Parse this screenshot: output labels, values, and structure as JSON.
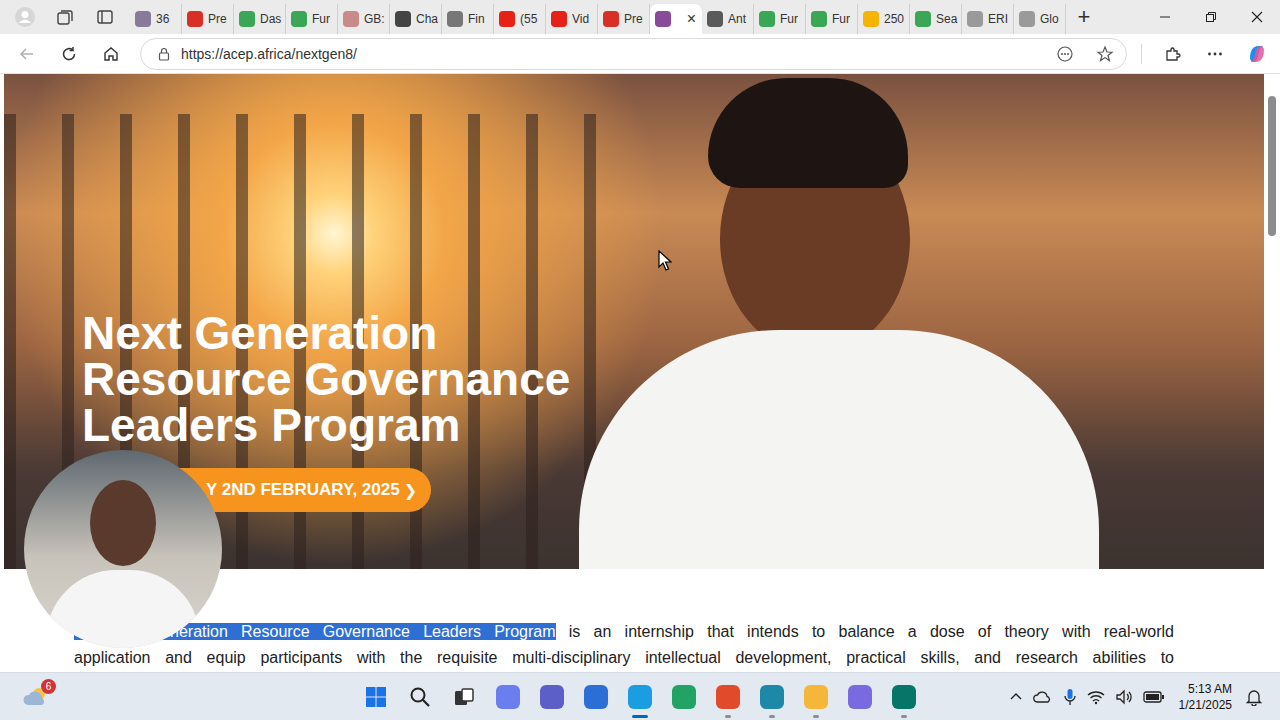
{
  "browser": {
    "tabs": [
      {
        "label": "36",
        "selected": false,
        "color": "#8a7a9a"
      },
      {
        "label": "Pre",
        "selected": false,
        "color": "#d93025"
      },
      {
        "label": "Das",
        "selected": false,
        "color": "#3aa757"
      },
      {
        "label": "Fur",
        "selected": false,
        "color": "#3aa757"
      },
      {
        "label": "GB:",
        "selected": false,
        "color": "#c98a8a"
      },
      {
        "label": "Cha",
        "selected": false,
        "color": "#444444"
      },
      {
        "label": "Fin",
        "selected": false,
        "color": "#777777"
      },
      {
        "label": "(55",
        "selected": false,
        "color": "#e62117"
      },
      {
        "label": "Vid",
        "selected": false,
        "color": "#e62117"
      },
      {
        "label": "Pre",
        "selected": false,
        "color": "#d93025"
      },
      {
        "label": "",
        "selected": true,
        "color": "#8a4a9a"
      },
      {
        "label": "Ant",
        "selected": false,
        "color": "#5a5a5a"
      },
      {
        "label": "Fur",
        "selected": false,
        "color": "#3aa757"
      },
      {
        "label": "Fur",
        "selected": false,
        "color": "#3aa757"
      },
      {
        "label": "250",
        "selected": false,
        "color": "#f4b400"
      },
      {
        "label": "Sea",
        "selected": false,
        "color": "#3aa757"
      },
      {
        "label": "ERI",
        "selected": false,
        "color": "#9a9a9a"
      },
      {
        "label": "Glo",
        "selected": false,
        "color": "#9a9a9a"
      }
    ],
    "close_glyph": "×",
    "new_tab": "+",
    "url": "https://acep.africa/nextgen8/"
  },
  "hero": {
    "title": "Next Generation Resource Governance Leaders Program",
    "cta": "Y 2ND FEBRUARY, 2025",
    "cta_glyph": "❯"
  },
  "intro": {
    "selected_text": "neration Resource Governance Leaders Program",
    "line1_rest": " is an internship that intends to balance a dose of theory with real-world",
    "line2": "application and equip participants with the requisite multi-disciplinary intellectual development, practical skills, and research abilities to"
  },
  "taskbar": {
    "weather_badge": "6",
    "apps": [
      {
        "color": "#6a7ef0",
        "running": false,
        "active": false
      },
      {
        "color": "#5b5fc7",
        "running": false,
        "active": false
      },
      {
        "color": "#2b6fd6",
        "running": false,
        "active": false
      },
      {
        "color": "#1b9de2",
        "running": true,
        "active": true
      },
      {
        "color": "#21a366",
        "running": false,
        "active": false
      },
      {
        "color": "#e14a2b",
        "running": true,
        "active": false
      },
      {
        "color": "#1e88a8",
        "running": true,
        "active": false
      },
      {
        "color": "#f4b73a",
        "running": true,
        "active": false
      },
      {
        "color": "#7a6ae0",
        "running": false,
        "active": false
      },
      {
        "color": "#077568",
        "running": true,
        "active": false
      }
    ],
    "time": "5:13 AM",
    "date": "1/21/2025"
  }
}
